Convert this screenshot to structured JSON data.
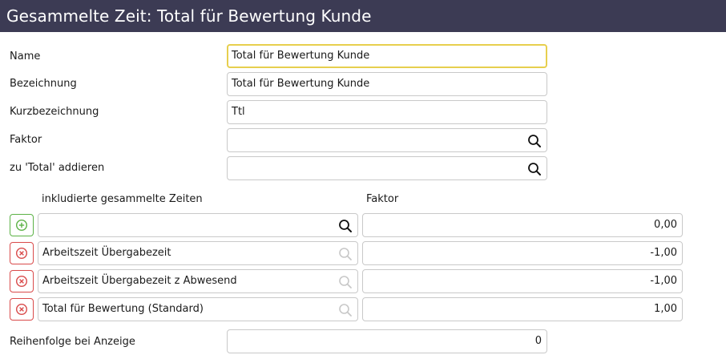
{
  "window": {
    "title": "Gesammelte Zeit: Total für Bewertung Kunde"
  },
  "form": {
    "name": {
      "label": "Name",
      "value": "Total für Bewertung Kunde"
    },
    "bezeichnung": {
      "label": "Bezeichnung",
      "value": "Total für Bewertung Kunde"
    },
    "kurzbezeichnung": {
      "label": "Kurzbezeichnung",
      "value": "Ttl"
    },
    "faktor": {
      "label": "Faktor",
      "value": ""
    },
    "zu_total": {
      "label": "zu 'Total' addieren",
      "value": ""
    },
    "reihenfolge": {
      "label": "Reihenfolge bei Anzeige",
      "value": "0"
    }
  },
  "included": {
    "column_times": "inkludierte gesammelte Zeiten",
    "column_factor": "Faktor",
    "new_row": {
      "time": "",
      "factor": "0,00"
    },
    "rows": [
      {
        "time": "Arbeitszeit Übergabezeit",
        "factor": "-1,00"
      },
      {
        "time": "Arbeitszeit Übergabezeit z Abwesend",
        "factor": "-1,00"
      },
      {
        "time": "Total für Bewertung (Standard)",
        "factor": "1,00"
      }
    ]
  },
  "icons": {
    "search": "search-icon",
    "add": "plus-circle-icon",
    "remove": "x-circle-icon"
  },
  "colors": {
    "titlebar": "#3c3b54",
    "focus_border": "#e7cf4e",
    "add_green": "#5cb246",
    "remove_red": "#d94a4a"
  }
}
